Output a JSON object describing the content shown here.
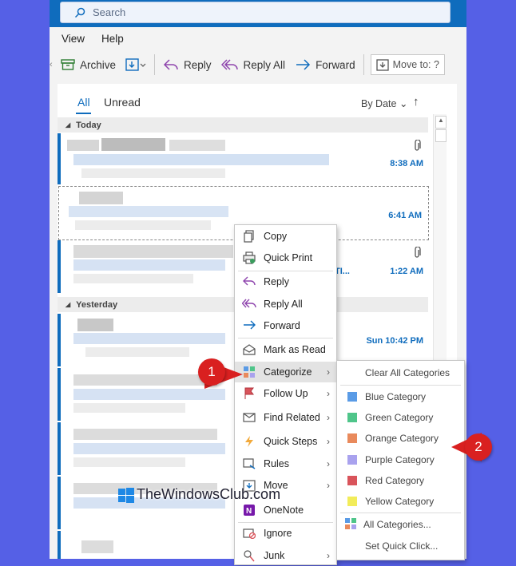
{
  "search": {
    "placeholder": "Search"
  },
  "menu": {
    "view": "View",
    "help": "Help"
  },
  "toolbar": {
    "archive": "Archive",
    "reply": "Reply",
    "reply_all": "Reply All",
    "forward": "Forward",
    "move_to": "Move to: ?"
  },
  "filters": {
    "all": "All",
    "unread": "Unread",
    "sort": "By Date",
    "sort_dir": "↑"
  },
  "groups": {
    "today": "Today",
    "yesterday": "Yesterday"
  },
  "messages": {
    "t1": "8:38 AM",
    "t2": "6:41 AM",
    "t3": "1:22 AM",
    "t3_subject_frag": "TI...",
    "t4": "Sun 10:42 PM"
  },
  "context_menu": {
    "copy": "Copy",
    "quick_print": "Quick Print",
    "reply": "Reply",
    "reply_all": "Reply All",
    "forward": "Forward",
    "mark_as_read": "Mark as Read",
    "categorize": "Categorize",
    "follow_up": "Follow Up",
    "find_related": "Find Related",
    "quick_steps": "Quick Steps",
    "rules": "Rules",
    "move": "Move",
    "onenote": "OneNote",
    "ignore": "Ignore",
    "junk": "Junk"
  },
  "categorize_menu": {
    "clear_all": "Clear All Categories",
    "items": [
      {
        "label": "Blue Category",
        "color": "#5a9be6"
      },
      {
        "label": "Green Category",
        "color": "#4fc58a"
      },
      {
        "label": "Orange Category",
        "color": "#e98a5c"
      },
      {
        "label": "Purple Category",
        "color": "#a9a2ee"
      },
      {
        "label": "Red Category",
        "color": "#d9545b"
      },
      {
        "label": "Yellow Category",
        "color": "#f2ec5a"
      }
    ],
    "all_categories": "All Categories...",
    "set_quick_click": "Set Quick Click..."
  },
  "callouts": {
    "one": "1",
    "two": "2"
  },
  "watermark": {
    "text": "TheWindowsClub.com"
  },
  "colors": {
    "accent": "#0f6cbd",
    "background": "#5560e6",
    "callout": "#d92020"
  }
}
